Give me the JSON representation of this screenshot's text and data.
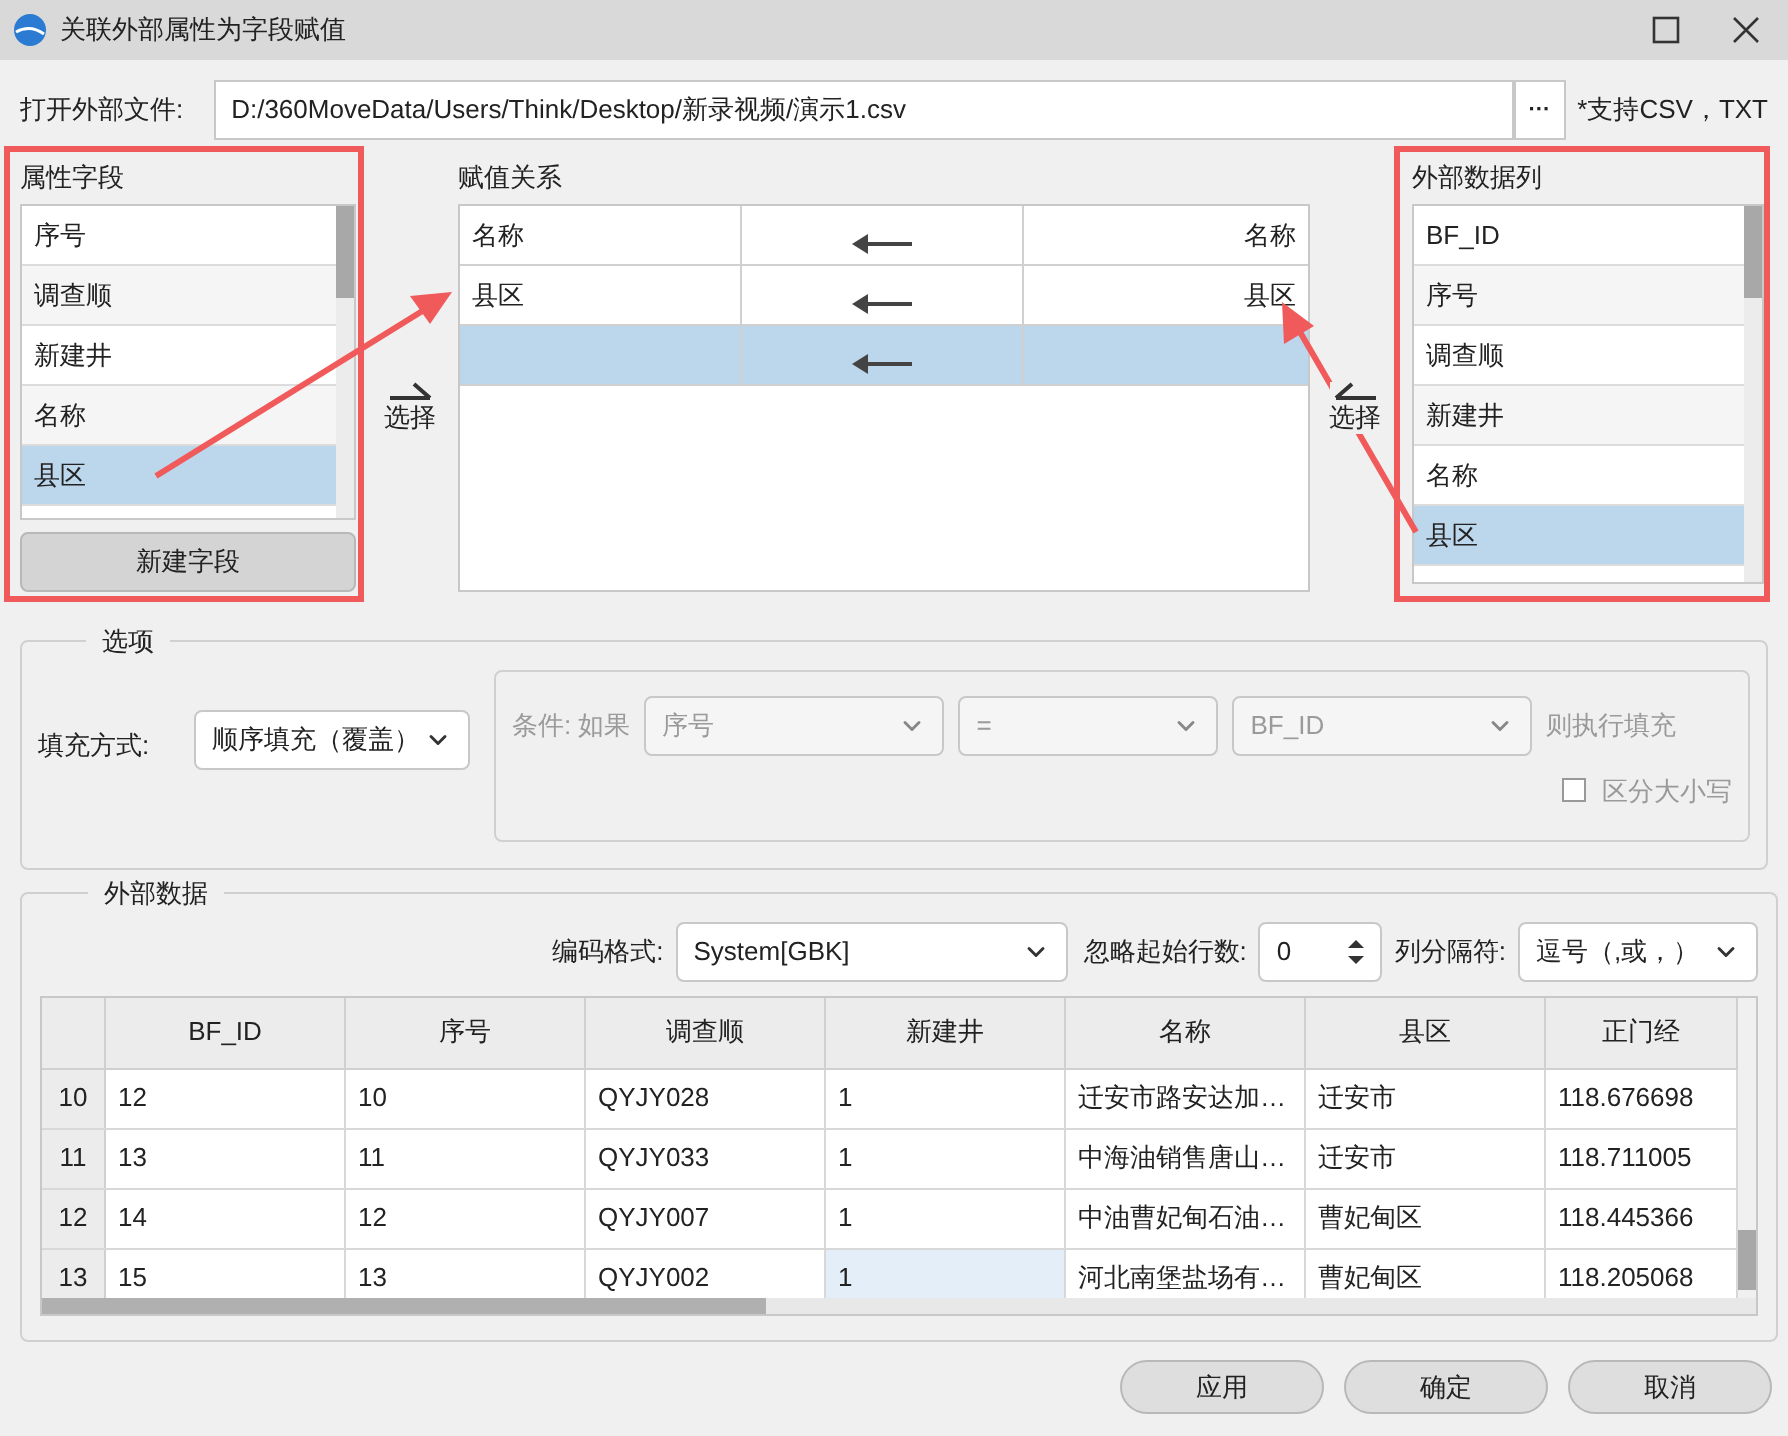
{
  "window": {
    "title": "关联外部属性为字段赋值"
  },
  "file": {
    "label": "打开外部文件:",
    "value": "D:/360MoveData/Users/Think/Desktop/新录视频/演示1.csv",
    "browse": "···",
    "note": "*支持CSV，TXT"
  },
  "attribute_fields": {
    "title": "属性字段",
    "items": [
      {
        "label": "序号",
        "selected": false
      },
      {
        "label": "调查顺",
        "selected": false
      },
      {
        "label": "新建井",
        "selected": false
      },
      {
        "label": "名称",
        "selected": false
      },
      {
        "label": "县区",
        "selected": true
      }
    ],
    "button": "新建字段"
  },
  "select_buttons": [
    "选择",
    "选择"
  ],
  "mapping": {
    "title": "赋值关系",
    "rows": [
      {
        "left": "名称",
        "right": "名称",
        "selected": false
      },
      {
        "left": "县区",
        "right": "县区",
        "selected": false
      },
      {
        "left": "",
        "right": "",
        "selected": true
      }
    ]
  },
  "external_columns": {
    "title": "外部数据列",
    "items": [
      {
        "label": "BF_ID",
        "selected": false
      },
      {
        "label": "序号",
        "selected": false
      },
      {
        "label": "调查顺",
        "selected": false
      },
      {
        "label": "新建井",
        "selected": false
      },
      {
        "label": "名称",
        "selected": false
      },
      {
        "label": "县区",
        "selected": true
      }
    ]
  },
  "options": {
    "title": "选项",
    "fill_label": "填充方式:",
    "fill_value": "顺序填充（覆盖）",
    "condition": {
      "disabled": true,
      "label": "条件: 如果",
      "field": "序号",
      "operator": "=",
      "value": "BF_ID",
      "then": "则执行填充",
      "case": {
        "label": "区分大小写",
        "checked": false
      }
    }
  },
  "external_data": {
    "title": "外部数据",
    "encoding_label": "编码格式:",
    "encoding": "System[GBK]",
    "skip_label": "忽略起始行数:",
    "skip_value": "0",
    "sep_label": "列分隔符:",
    "sep_value": "逗号（,或，）",
    "table": {
      "columns": [
        "BF_ID",
        "序号",
        "调查顺",
        "新建井",
        "名称",
        "县区",
        "正门经"
      ],
      "rows": [
        {
          "index": "10",
          "cells": [
            {
              "text": "12",
              "selected": false
            },
            {
              "text": "10",
              "selected": false
            },
            {
              "text": "QYJY028",
              "selected": false
            },
            {
              "text": "1",
              "selected": false
            },
            {
              "text": "迁安市路安达加…",
              "selected": false
            },
            {
              "text": "迁安市",
              "selected": false
            },
            {
              "text": "118.676698",
              "selected": false
            }
          ]
        },
        {
          "index": "11",
          "cells": [
            {
              "text": "13",
              "selected": false
            },
            {
              "text": "11",
              "selected": false
            },
            {
              "text": "QYJY033",
              "selected": false
            },
            {
              "text": "1",
              "selected": false
            },
            {
              "text": "中海油销售唐山…",
              "selected": false
            },
            {
              "text": "迁安市",
              "selected": false
            },
            {
              "text": "118.711005",
              "selected": false
            }
          ]
        },
        {
          "index": "12",
          "cells": [
            {
              "text": "14",
              "selected": false
            },
            {
              "text": "12",
              "selected": false
            },
            {
              "text": "QYJY007",
              "selected": false
            },
            {
              "text": "1",
              "selected": false
            },
            {
              "text": "中油曹妃甸石油…",
              "selected": false
            },
            {
              "text": "曹妃甸区",
              "selected": false
            },
            {
              "text": "118.445366",
              "selected": false
            }
          ]
        },
        {
          "index": "13",
          "cells": [
            {
              "text": "15",
              "selected": false
            },
            {
              "text": "13",
              "selected": false
            },
            {
              "text": "QYJY002",
              "selected": false
            },
            {
              "text": "1",
              "selected": true
            },
            {
              "text": "河北南堡盐场有…",
              "selected": false
            },
            {
              "text": "曹妃甸区",
              "selected": false
            },
            {
              "text": "118.205068",
              "selected": false
            }
          ]
        }
      ]
    }
  },
  "buttons": [
    "应用",
    "确定",
    "取消"
  ]
}
